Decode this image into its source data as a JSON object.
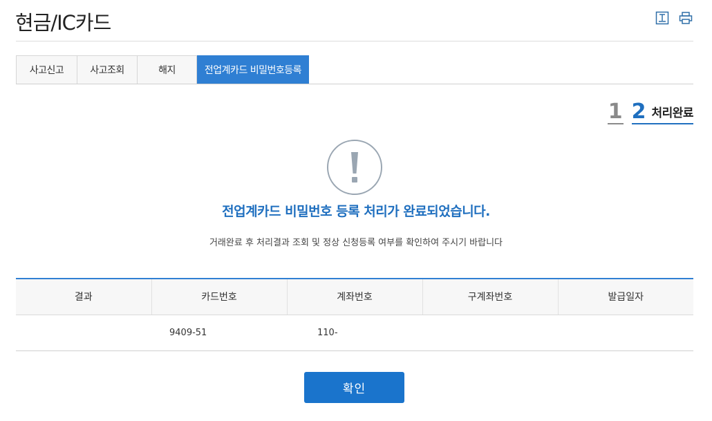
{
  "header": {
    "title": "현금/IC카드",
    "icons": [
      "download-icon",
      "print-icon"
    ]
  },
  "tabs": [
    {
      "label": "사고신고",
      "active": false
    },
    {
      "label": "사고조회",
      "active": false
    },
    {
      "label": "해지",
      "active": false
    },
    {
      "label": "전업계카드 비밀번호등록",
      "active": true
    }
  ],
  "steps": {
    "step1": "1",
    "step2": "2",
    "step2_label": "처리완료"
  },
  "result": {
    "icon": "exclamation-circle-icon",
    "title": "전업계카드 비밀번호 등록 처리가 완료되었습니다.",
    "subtitle": "거래완료 후 처리결과 조회 및 정상 신청등록 여부를 확인하여 주시기 바랍니다"
  },
  "table": {
    "headers": [
      "결과",
      "카드번호",
      "계좌번호",
      "구계좌번호",
      "발급일자"
    ],
    "rows": [
      [
        "",
        "9409-51",
        "110-",
        "",
        ""
      ]
    ]
  },
  "confirm_label": "확인",
  "colors": {
    "accent": "#1f6fbf",
    "tab_active": "#2f7fd3",
    "button": "#1a74cc"
  }
}
